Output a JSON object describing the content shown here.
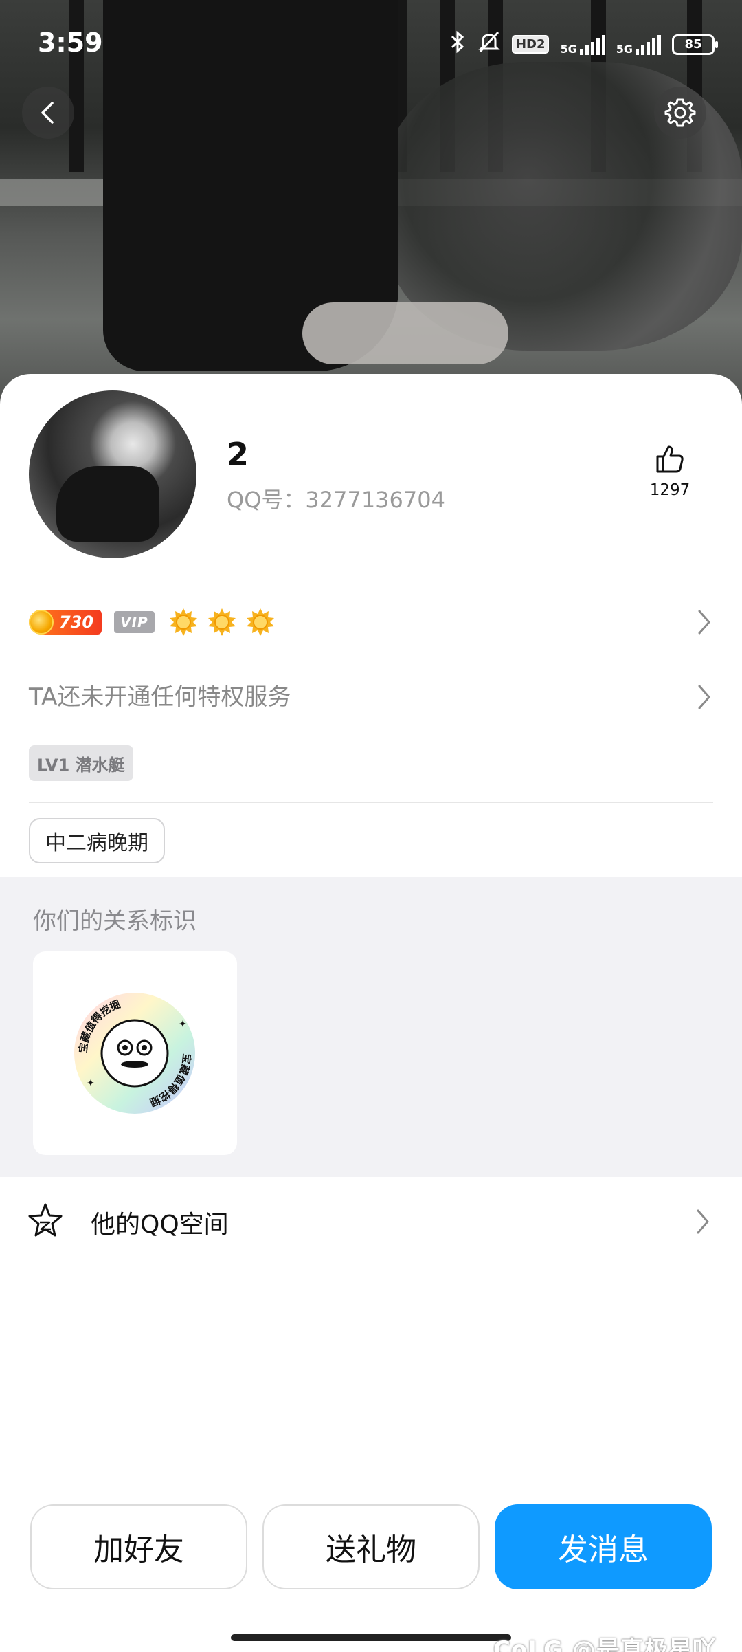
{
  "status_bar": {
    "time": "3:59",
    "hd_label": "HD2",
    "network_1": "5G",
    "network_2": "5G",
    "battery": "85"
  },
  "profile": {
    "nickname": "2",
    "qq_number": "QQ号：3277136704",
    "likes": "1297"
  },
  "badges": {
    "coin_level": "730",
    "vip_label": "VIP",
    "sun_icon_count": 3
  },
  "privilege_text": "TA还未开通任何特权服务",
  "level_tag": "LV1 潜水艇",
  "personal_tag": "中二病晚期",
  "relationship": {
    "title": "你们的关系标识",
    "sticker_text": "宝藏值得挖掘"
  },
  "qzone_label": "他的QQ空间",
  "buttons": {
    "add_friend": "加好友",
    "send_gift": "送礼物",
    "send_message": "发消息"
  },
  "watermark": "CoLG @是真极星吖",
  "colors": {
    "primary": "#0f9aff",
    "coin_badge": "#f43b1f",
    "section_bg": "#f2f2f5"
  }
}
